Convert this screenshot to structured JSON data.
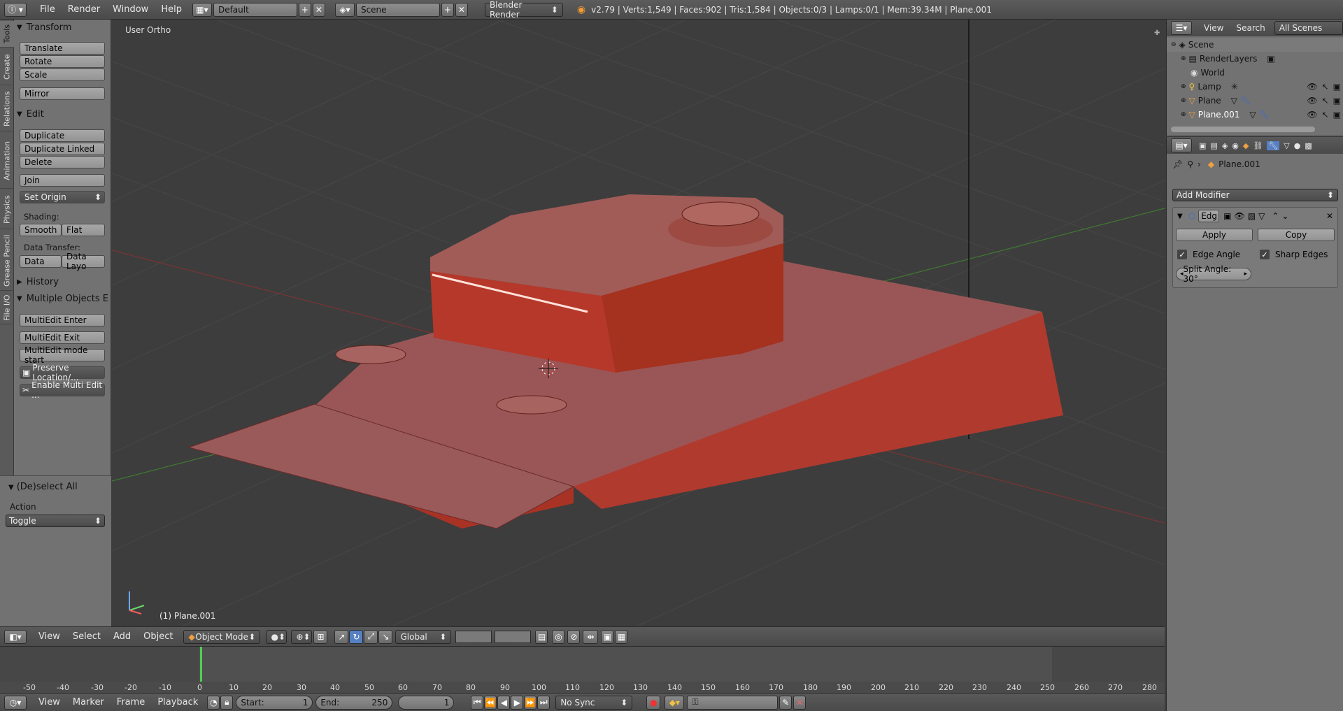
{
  "topbar": {
    "menus": [
      "File",
      "Render",
      "Window",
      "Help"
    ],
    "layout": "Default",
    "scene": "Scene",
    "engine": "Blender Render",
    "stats": "v2.79 | Verts:1,549 | Faces:902 | Tris:1,584 | Objects:0/3 | Lamps:0/1 | Mem:39.34M | Plane.001"
  },
  "tabs": [
    "Tools",
    "Create",
    "Relations",
    "Animation",
    "Physics",
    "Grease Pencil",
    "File I/O"
  ],
  "tools": {
    "transform_title": "Transform",
    "translate": "Translate",
    "rotate": "Rotate",
    "scale": "Scale",
    "mirror": "Mirror",
    "edit_title": "Edit",
    "duplicate": "Duplicate",
    "duplicate_linked": "Duplicate Linked",
    "delete": "Delete",
    "join": "Join",
    "set_origin": "Set Origin",
    "shading_label": "Shading:",
    "smooth": "Smooth",
    "flat": "Flat",
    "data_transfer_label": "Data Transfer:",
    "data": "Data",
    "data_layo": "Data Layo",
    "history_title": "History",
    "multi_title": "Multiple Objects Edit",
    "multi_enter": "MultiEdit Enter",
    "multi_exit": "MultiEdit Exit",
    "multi_mode_start": "MultiEdit mode start",
    "preserve_location": "Preserve Location/...",
    "enable_multi": "Enable Multi Edit ..."
  },
  "operator": {
    "title": "(De)select All",
    "action_label": "Action",
    "action_value": "Toggle"
  },
  "viewport": {
    "view_name": "User Ortho",
    "object_label": "(1) Plane.001"
  },
  "vp_header": {
    "menus": [
      "View",
      "Select",
      "Add",
      "Object"
    ],
    "mode": "Object Mode",
    "orientation": "Global"
  },
  "timeline": {
    "ticks": [
      "-50",
      "-40",
      "-30",
      "-20",
      "-10",
      "0",
      "10",
      "20",
      "30",
      "40",
      "50",
      "60",
      "70",
      "80",
      "90",
      "100",
      "110",
      "120",
      "130",
      "140",
      "150",
      "160",
      "170",
      "180",
      "190",
      "200",
      "210",
      "220",
      "230",
      "240",
      "250",
      "260",
      "270",
      "280"
    ],
    "menus": [
      "View",
      "Marker",
      "Frame",
      "Playback"
    ],
    "start_label": "Start:",
    "start_value": "1",
    "end_label": "End:",
    "end_value": "250",
    "current_frame": "1",
    "sync": "No Sync"
  },
  "outliner": {
    "menus": [
      "View",
      "Search"
    ],
    "filter": "All Scenes",
    "items": [
      {
        "label": "Scene"
      },
      {
        "label": "RenderLayers"
      },
      {
        "label": "World"
      },
      {
        "label": "Lamp"
      },
      {
        "label": "Plane"
      },
      {
        "label": "Plane.001"
      }
    ]
  },
  "properties": {
    "object_name": "Plane.001",
    "add_modifier": "Add Modifier",
    "modifier_name": "Edg",
    "apply": "Apply",
    "copy": "Copy",
    "edge_angle": "Edge Angle",
    "sharp_edges": "Sharp Edges",
    "split_angle": "Split Angle: 30°"
  },
  "colors": {
    "object": "#b83a2e",
    "grid": "#4a4a4a",
    "x_axis": "#8a3a3a",
    "y_axis": "#4a8a3a"
  }
}
